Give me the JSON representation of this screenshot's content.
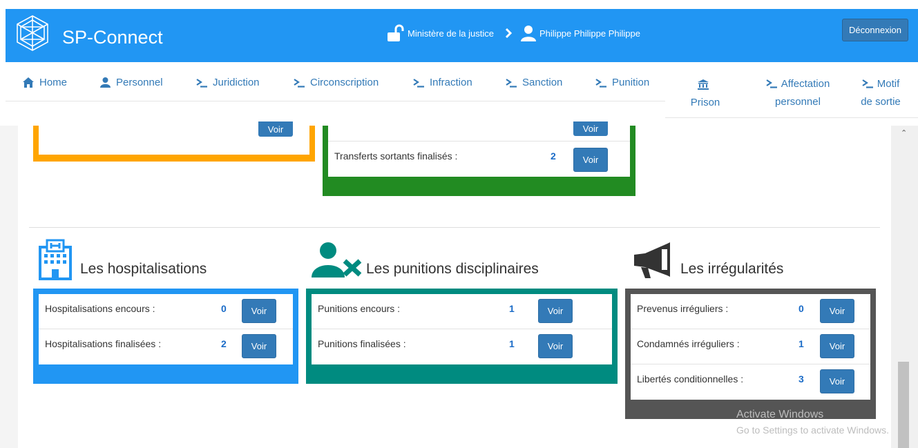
{
  "header": {
    "brand": "SP-Connect",
    "ministry": "Ministère de la justice",
    "user": "Philippe Philippe Philippe",
    "logout_label": "Déconnexion"
  },
  "nav": {
    "items": [
      {
        "label": "Home",
        "icon": "home-icon"
      },
      {
        "label": "Personnel",
        "icon": "user-icon"
      },
      {
        "label": "Juridiction",
        "icon": "terminal-icon"
      },
      {
        "label": "Circonscription",
        "icon": "terminal-icon"
      },
      {
        "label": "Infraction",
        "icon": "terminal-icon"
      },
      {
        "label": "Sanction",
        "icon": "terminal-icon"
      },
      {
        "label": "Punition",
        "icon": "terminal-icon"
      }
    ],
    "prison": {
      "line1": "",
      "line2": "Prison",
      "icon": "bank-icon"
    },
    "affectation": {
      "line1": "Affectation",
      "line2": "personnel",
      "icon": "terminal-icon"
    },
    "motif": {
      "line1": "Motif",
      "line2": "de sortie",
      "icon": "terminal-icon"
    }
  },
  "top_panels": {
    "orange": {
      "color": "#ffa500",
      "partial_button": "Voir"
    },
    "green": {
      "color": "#228b22",
      "partial_button": "Voir",
      "rows": [
        {
          "label": "Transferts sortants finalisés :",
          "value": "2",
          "button": "Voir"
        }
      ]
    }
  },
  "sections": {
    "hospitalisations": {
      "title": "Les hospitalisations",
      "icon": "hospital-icon",
      "color": "#2196f3",
      "rows": [
        {
          "label": "Hospitalisations encours :",
          "value": "0",
          "button": "Voir"
        },
        {
          "label": "Hospitalisations finalisées :",
          "value": "2",
          "button": "Voir"
        }
      ]
    },
    "punitions": {
      "title": "Les punitions disciplinaires",
      "icon": "user-remove-icon",
      "color": "#008b80",
      "rows": [
        {
          "label": "Punitions encours :",
          "value": "1",
          "button": "Voir"
        },
        {
          "label": "Punitions finalisées :",
          "value": "1",
          "button": "Voir"
        }
      ]
    },
    "irregularites": {
      "title": "Les irrégularités",
      "icon": "megaphone-icon",
      "color": "#555555",
      "rows": [
        {
          "label": "Prevenus irréguliers :",
          "value": "0",
          "button": "Voir"
        },
        {
          "label": "Condamnés irréguliers :",
          "value": "1",
          "button": "Voir"
        },
        {
          "label": "Libertés conditionnelles :",
          "value": "3",
          "button": "Voir"
        }
      ]
    }
  },
  "watermark": {
    "line1": "Activate Windows",
    "line2": "Go to Settings to activate Windows."
  },
  "colors": {
    "header": "#2196f3",
    "link": "#337ab7",
    "button": "#337ab7",
    "value": "#1a6bc7"
  }
}
